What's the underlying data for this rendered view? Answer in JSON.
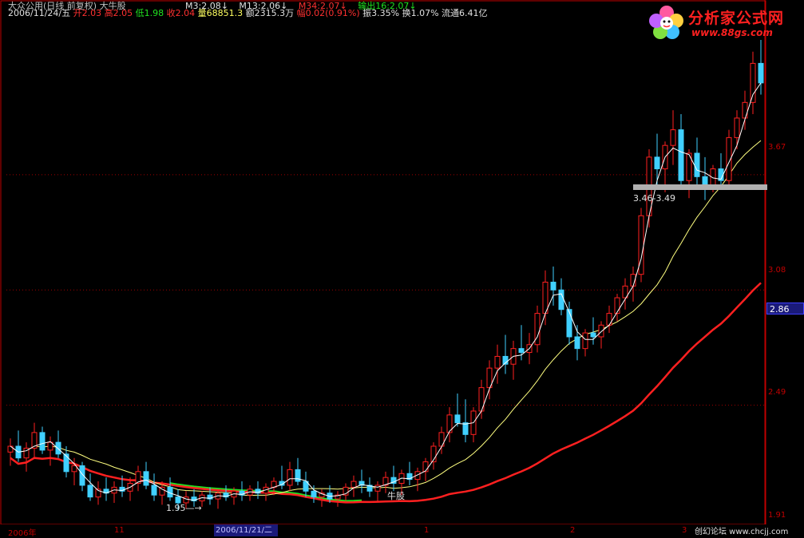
{
  "header": {
    "title": "大众公用(日线 前复权) 大牛股",
    "date": "2006/11/24/五",
    "open_label": "开",
    "open": "2.03",
    "high_label": "高",
    "high": "2.05",
    "low_label": "低",
    "low": "1.98",
    "close_label": "收",
    "close": "2.04",
    "volume_label": "量",
    "volume": "68851.3",
    "amount_label": "额",
    "amount": "2315.3万",
    "change_label": "幅",
    "change": "0.02(0.91%)",
    "amplitude": "振3.35%",
    "turnover": "换1.07%",
    "float": "流通6.41亿"
  },
  "indicators": [
    {
      "text": "M3:2.08↓",
      "color": "#e0e0e0"
    },
    {
      "text": "M13:2.06↓",
      "color": "#e0e0e0"
    },
    {
      "text": "M34:2.07↓",
      "color": "#ff3030"
    },
    {
      "text": "输出16:2.07↓",
      "color": "#20e020"
    }
  ],
  "logo": {
    "title": "分析家公式网",
    "url": "www.88gs.com"
  },
  "y_axis": {
    "labels": [
      {
        "text": "3.67",
        "color": "#c00000"
      },
      {
        "text": "3.08",
        "color": "#c00000"
      },
      {
        "text": "2.49",
        "color": "#c00000"
      },
      {
        "text": "1.91",
        "color": "#c00000"
      }
    ],
    "current_price": "2.86"
  },
  "x_axis": {
    "labels": [
      "2006年",
      "11",
      "1",
      "2",
      "3"
    ],
    "selected": "2006/11/21/二"
  },
  "annotations": {
    "low_marker": "1.95—→",
    "range_label": "3.46-3.49",
    "bull_label": "牛股"
  },
  "footer": "创幻论坛 www.chcjj.com",
  "colors": {
    "up": "#ff2020",
    "down": "#40d0ff",
    "ma_fast": "#ffffff",
    "ma_mid": "#ffff80",
    "ma_slow": "#ff2020",
    "band": "#20e020"
  },
  "chart_data": {
    "type": "candlestick",
    "ylim": [
      1.9,
      4.45
    ],
    "candles": [
      [
        2.25,
        2.32,
        2.18,
        2.28
      ],
      [
        2.28,
        2.36,
        2.2,
        2.22
      ],
      [
        2.22,
        2.3,
        2.15,
        2.27
      ],
      [
        2.27,
        2.4,
        2.22,
        2.35
      ],
      [
        2.35,
        2.38,
        2.24,
        2.26
      ],
      [
        2.26,
        2.33,
        2.18,
        2.3
      ],
      [
        2.3,
        2.36,
        2.22,
        2.24
      ],
      [
        2.24,
        2.28,
        2.12,
        2.15
      ],
      [
        2.15,
        2.22,
        2.08,
        2.18
      ],
      [
        2.18,
        2.2,
        2.05,
        2.08
      ],
      [
        2.08,
        2.14,
        2.0,
        2.02
      ],
      [
        2.02,
        2.1,
        1.98,
        2.06
      ],
      [
        2.06,
        2.12,
        2.0,
        2.04
      ],
      [
        2.04,
        2.1,
        1.99,
        2.07
      ],
      [
        2.07,
        2.13,
        2.02,
        2.05
      ],
      [
        2.05,
        2.12,
        2.0,
        2.09
      ],
      [
        2.09,
        2.18,
        2.05,
        2.15
      ],
      [
        2.15,
        2.2,
        2.06,
        2.08
      ],
      [
        2.08,
        2.14,
        2.0,
        2.03
      ],
      [
        2.03,
        2.1,
        1.98,
        2.07
      ],
      [
        2.07,
        2.12,
        2.0,
        2.02
      ],
      [
        2.02,
        2.06,
        1.95,
        1.99
      ],
      [
        1.99,
        2.05,
        1.96,
        2.02
      ],
      [
        2.02,
        2.06,
        1.97,
        2.0
      ],
      [
        2.0,
        2.05,
        1.97,
        2.03
      ],
      [
        2.03,
        2.07,
        1.98,
        2.01
      ],
      [
        2.01,
        2.05,
        1.96,
        2.04
      ],
      [
        2.04,
        2.08,
        2.0,
        2.02
      ],
      [
        2.02,
        2.07,
        1.98,
        2.05
      ],
      [
        2.05,
        2.1,
        2.0,
        2.03
      ],
      [
        2.03,
        2.08,
        2.0,
        2.06
      ],
      [
        2.06,
        2.1,
        2.01,
        2.04
      ],
      [
        2.04,
        2.09,
        2.0,
        2.07
      ],
      [
        2.07,
        2.12,
        2.03,
        2.1
      ],
      [
        2.1,
        2.18,
        2.06,
        2.08
      ],
      [
        2.08,
        2.2,
        2.05,
        2.16
      ],
      [
        2.16,
        2.22,
        2.08,
        2.1
      ],
      [
        2.1,
        2.15,
        2.02,
        2.05
      ],
      [
        2.05,
        2.08,
        1.99,
        2.02
      ],
      [
        2.02,
        2.06,
        1.97,
        2.04
      ],
      [
        2.04,
        2.08,
        1.99,
        2.01
      ],
      [
        2.01,
        2.05,
        1.97,
        2.03
      ],
      [
        2.03,
        2.09,
        2.0,
        2.07
      ],
      [
        2.07,
        2.13,
        2.02,
        2.1
      ],
      [
        2.1,
        2.16,
        2.04,
        2.08
      ],
      [
        2.08,
        2.12,
        2.02,
        2.05
      ],
      [
        2.05,
        2.1,
        2.0,
        2.08
      ],
      [
        2.08,
        2.15,
        2.04,
        2.12
      ],
      [
        2.12,
        2.18,
        2.05,
        2.09
      ],
      [
        2.09,
        2.16,
        2.03,
        2.14
      ],
      [
        2.14,
        2.2,
        2.08,
        2.11
      ],
      [
        2.11,
        2.17,
        2.05,
        2.15
      ],
      [
        2.15,
        2.22,
        2.1,
        2.2
      ],
      [
        2.2,
        2.3,
        2.16,
        2.28
      ],
      [
        2.28,
        2.38,
        2.24,
        2.35
      ],
      [
        2.35,
        2.48,
        2.3,
        2.44
      ],
      [
        2.44,
        2.55,
        2.38,
        2.4
      ],
      [
        2.4,
        2.52,
        2.3,
        2.34
      ],
      [
        2.34,
        2.48,
        2.3,
        2.46
      ],
      [
        2.46,
        2.62,
        2.42,
        2.58
      ],
      [
        2.58,
        2.72,
        2.52,
        2.68
      ],
      [
        2.68,
        2.8,
        2.6,
        2.74
      ],
      [
        2.74,
        2.85,
        2.65,
        2.7
      ],
      [
        2.7,
        2.82,
        2.62,
        2.78
      ],
      [
        2.78,
        2.9,
        2.72,
        2.76
      ],
      [
        2.76,
        2.86,
        2.7,
        2.8
      ],
      [
        2.8,
        3.0,
        2.76,
        2.96
      ],
      [
        2.96,
        3.18,
        2.9,
        3.12
      ],
      [
        3.12,
        3.2,
        3.0,
        3.08
      ],
      [
        3.08,
        3.14,
        2.95,
        2.98
      ],
      [
        2.98,
        3.02,
        2.8,
        2.84
      ],
      [
        2.84,
        2.9,
        2.72,
        2.78
      ],
      [
        2.78,
        2.88,
        2.74,
        2.86
      ],
      [
        2.86,
        2.94,
        2.8,
        2.84
      ],
      [
        2.84,
        2.92,
        2.78,
        2.9
      ],
      [
        2.9,
        3.0,
        2.86,
        2.96
      ],
      [
        2.96,
        3.06,
        2.92,
        3.04
      ],
      [
        3.04,
        3.14,
        2.98,
        3.1
      ],
      [
        3.1,
        3.2,
        3.02,
        3.16
      ],
      [
        3.16,
        3.5,
        3.12,
        3.46
      ],
      [
        3.46,
        3.8,
        3.4,
        3.76
      ],
      [
        3.76,
        3.88,
        3.62,
        3.7
      ],
      [
        3.7,
        3.84,
        3.58,
        3.82
      ],
      [
        3.82,
        4.0,
        3.72,
        3.9
      ],
      [
        3.9,
        3.98,
        3.6,
        3.64
      ],
      [
        3.64,
        3.8,
        3.55,
        3.78
      ],
      [
        3.78,
        3.86,
        3.6,
        3.66
      ],
      [
        3.66,
        3.76,
        3.54,
        3.6
      ],
      [
        3.6,
        3.72,
        3.58,
        3.7
      ],
      [
        3.7,
        3.78,
        3.6,
        3.64
      ],
      [
        3.64,
        3.9,
        3.6,
        3.86
      ],
      [
        3.86,
        4.0,
        3.8,
        3.96
      ],
      [
        3.96,
        4.1,
        3.9,
        4.04
      ],
      [
        4.04,
        4.3,
        3.98,
        4.24
      ],
      [
        4.24,
        4.36,
        4.08,
        4.14
      ]
    ]
  }
}
